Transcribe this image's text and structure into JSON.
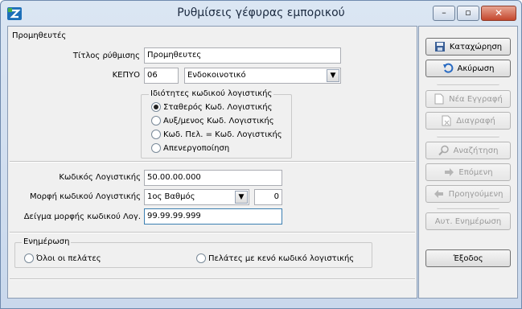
{
  "window": {
    "title": "Ρυθμίσεις γέφυρας εμπορικού"
  },
  "group_supplier": {
    "title": "Προμηθευτές"
  },
  "form": {
    "title_label": "Τίτλος ρύθμισης",
    "title_value": "Προμηθευτες",
    "kepyo_label": "ΚΕΠΥΟ",
    "kepyo_code": "06",
    "kepyo_select": "Ενδοκοινοτικό"
  },
  "code_props": {
    "title": "Ιδιότητες κωδικού λογιστικής",
    "options": [
      {
        "label": "Σταθερός Κωδ. Λογιστικής",
        "selected": true
      },
      {
        "label": "Αυξ/μενος Κωδ. Λογιστικής",
        "selected": false
      },
      {
        "label": "Κωδ. Πελ. = Κωδ. Λογιστικής",
        "selected": false
      },
      {
        "label": "Απενεργοποίηση",
        "selected": false
      }
    ]
  },
  "account": {
    "code_label": "Κωδικός Λογιστικής",
    "code_value": "50.00.00.000",
    "format_label": "Μορφή κωδικού Λογιστικής",
    "format_value": "1ος Βαθμός",
    "format_number": "0",
    "sample_label": "Δείγμα μορφής κωδικού Λογ.",
    "sample_value": "99.99.99.999"
  },
  "update": {
    "title": "Ενημέρωση",
    "all_customers": "Όλοι οι πελάτες",
    "empty_code_customers": "Πελάτες με κενό κωδικό λογιστικής"
  },
  "actions": {
    "save": "Καταχώρηση",
    "cancel": "Ακύρωση",
    "new": "Νέα Εγγραφή",
    "delete": "Διαγραφή",
    "search": "Αναζήτηση",
    "next": "Επόμενη",
    "previous": "Προηγούμενη",
    "auto_update": "Αυτ. Ενημέρωση",
    "exit": "Έξοδος"
  }
}
